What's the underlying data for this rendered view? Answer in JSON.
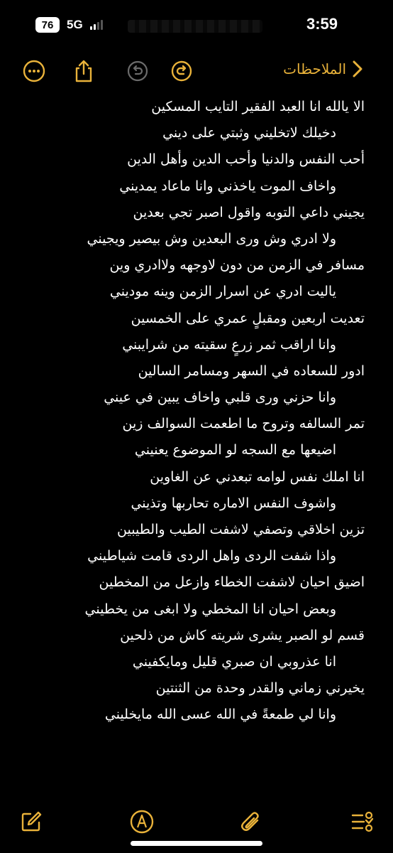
{
  "status": {
    "battery": "76",
    "network": "5G",
    "time": "3:59"
  },
  "toolbar": {
    "back_label": "الملاحظات",
    "icons": [
      "more-icon",
      "share-icon",
      "undo-icon",
      "redo-icon",
      "back-chevron-icon"
    ]
  },
  "note": {
    "lines": [
      "الا يالله انا العبد الفقير التايب المسكين",
      "دخيلك لاتخليني وثبتي على ديني",
      "أحب النفس والدنيا وأحب الدين وأهل الدين",
      "واخاف الموت ياخذني وانا ماعاد يمديني",
      "يجيني داعي التوبه واقول اصبر تجي بعدين",
      "ولا ادري وش ورى البعدين وش بيصير ويجيني",
      "مسافر في الزمن من دون لاوجهه ولاادري وين",
      "ياليت ادري عن اسرار الزمن وينه موديني",
      "تعديت اربعين ومقبلٍ عمري على الخمسين",
      "وانا اراقب ثمر زرعٍ سقيته من شرايبني",
      "ادور للسعاده في السهر ومسامر السالين",
      "وانا حزني ورى قلبي واخاف يبين في عيني",
      "تمر السالفه وتروح ما اطعمت السوالف زين",
      "اضيعها مع السجه لو الموضوع يعنيني",
      "انا املك نفس لوامه تبعدني عن الغاوين",
      "واشوف النفس الاماره تحاربها وتذيني",
      "تزين اخلاقي وتصفي لاشفت الطيب والطيبين",
      "واذا شفت الردى واهل الردى قامت شياطيني",
      "اضيق احيان لاشفت الخطاء وازعل من المخطين",
      "وبعض احيان انا المخطي ولا ابغى من يخطيني",
      "قسم لو الصبر يشرى شريته كاش من ذلحين",
      "انا عذروبي ان صبري قليل ومايكفيني",
      "يخيرني زماني والقدر وحدة من الثنتين",
      "وانا لي طمعةً في الله عسى الله مايخليني"
    ]
  },
  "bottom_toolbar": {
    "icons": [
      "compose-icon",
      "markup-icon",
      "attachment-icon",
      "checklist-icon"
    ]
  },
  "colors": {
    "accent": "#e9b23a",
    "background": "#000000",
    "text": "#ffffff"
  }
}
